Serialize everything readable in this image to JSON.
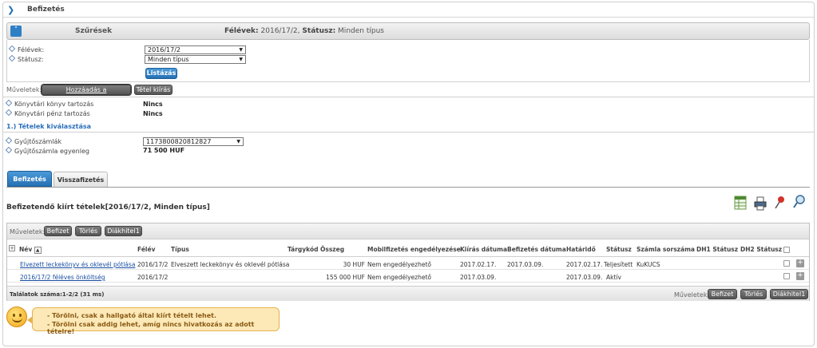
{
  "page": {
    "title": "Befizetés"
  },
  "filter": {
    "label": "Szűrések",
    "summary_semester_label": "Félévek:",
    "summary_semester_value": "2016/17/2,",
    "summary_status_label": "Státusz:",
    "summary_status_value": "Minden típus",
    "semester_label": "Félévek:",
    "semester_value": "2016/17/2",
    "status_label": "Státusz:",
    "status_value": "Minden típus",
    "list_button": "Listázás"
  },
  "operations": {
    "label": "Műveletek:",
    "favorite_button": "Hozzáadás a kedvencekhez",
    "print_button": "Tétel kiírás"
  },
  "debts": {
    "library_book_label": "Könyvtári könyv tartozás",
    "library_book_value": "Nincs",
    "library_money_label": "Könyvtári pénz tartozás",
    "library_money_value": "Nincs"
  },
  "section_title": "1.) Tételek kiválasztása",
  "account": {
    "accounts_label": "Gyűjtőszámlák",
    "accounts_value": "1173800820812827",
    "balance_label": "Gyűjtőszámla egyenleg",
    "balance_value": "71 500 HUF"
  },
  "tabs": [
    {
      "label": "Befizetés"
    },
    {
      "label": "Visszafizetés"
    }
  ],
  "list": {
    "title": "Befizetendő kiírt tételek[2016/17/2, Minden típus]",
    "ops_label": "Műveletek:",
    "ops_buttons": [
      "Befizet",
      "Törlés",
      "Diákhitel1"
    ],
    "columns": [
      "Név",
      "Félév",
      "Típus",
      "Tárgykód",
      "Összeg",
      "Mobilfizetés engedélyezése",
      "Kiírás dátuma",
      "Befizetés dátuma",
      "Határidő",
      "Státusz",
      "Számla sorszáma",
      "DH1 Státusz",
      "DH2 Státusz"
    ],
    "rows": [
      {
        "name": "Elvezett leckekönyv és oklevél pótlása",
        "semester": "2016/17/2",
        "type": "Elveszett leckekönyv és oklevél pótlása",
        "code": "",
        "amount": "30 HUF",
        "mobile": "Nem engedélyezhető",
        "issued": "2017.02.17.",
        "paid": "2017.03.09.",
        "deadline": "2017.02.17.",
        "status": "Teljesített",
        "invoice": "KuKUCS",
        "dh1": "",
        "dh2": ""
      },
      {
        "name": "2016/17/2 féléves önköltség",
        "semester": "2016/17/2",
        "type": "",
        "code": "",
        "amount": "155 000 HUF",
        "mobile": "Nem engedélyezhető",
        "issued": "2017.03.09.",
        "paid": "",
        "deadline": "2017.03.09.",
        "status": "Aktív",
        "invoice": "",
        "dh1": "",
        "dh2": ""
      }
    ],
    "count_text": "Találatok száma:1-2/2 (31 ms)",
    "footer_ops_label": "Műveletek:"
  },
  "tip": {
    "line1": "- Törölni, csak a hallgató által kiírt tételt lehet.",
    "line2": "- Törölni csak addig lehet, amíg nincs hivatkozás az adott tételre!"
  },
  "colors": {
    "accent": "#2470b3",
    "link": "#1a4fa3",
    "tip_bg": "#fde9b8"
  }
}
